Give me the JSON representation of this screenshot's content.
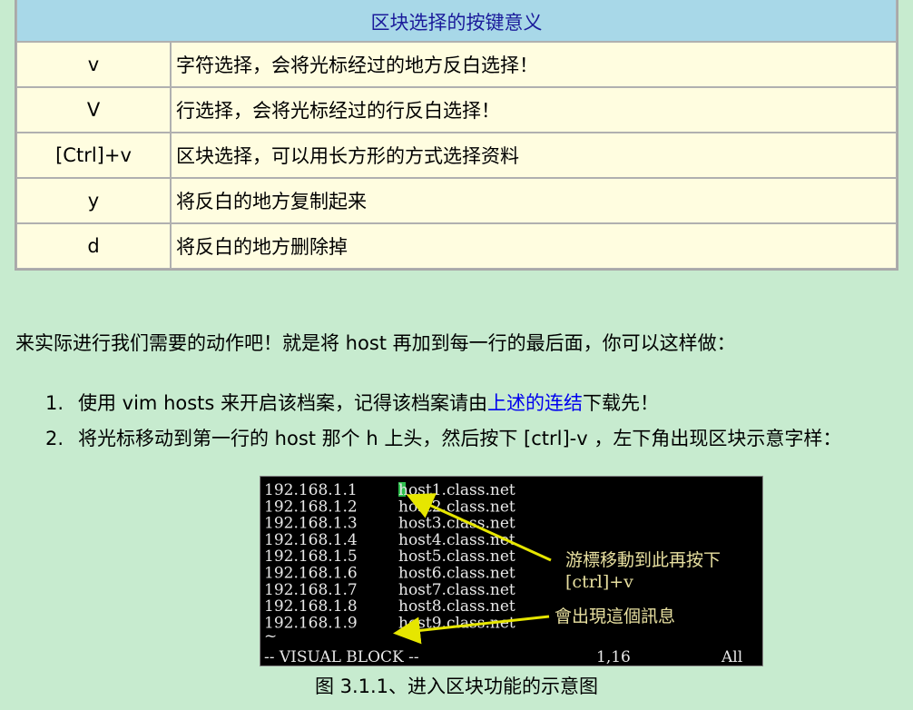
{
  "table": {
    "header": "区块选择的按键意义",
    "rows": [
      {
        "key": "v",
        "desc": "字符选择，会将光标经过的地方反白选择！"
      },
      {
        "key": "V",
        "desc": "行选择，会将光标经过的行反白选择！"
      },
      {
        "key": "[Ctrl]+v",
        "desc": "区块选择，可以用长方形的方式选择资料"
      },
      {
        "key": "y",
        "desc": "将反白的地方复制起来"
      },
      {
        "key": "d",
        "desc": "将反白的地方删除掉"
      }
    ]
  },
  "intro": "来实际进行我们需要的动作吧！就是将 host 再加到每一行的最后面，你可以这样做：",
  "steps": [
    {
      "num": "1.",
      "before": "使用 vim hosts 来开启该档案，记得该档案请由",
      "link": "上述的连结",
      "after": "下载先！"
    },
    {
      "num": "2.",
      "text": "将光标移动到第一行的 host 那个 h 上头，然后按下 [ctrl]-v ，左下角出现区块示意字样："
    }
  ],
  "terminal": {
    "lines": [
      {
        "ip": "192.168.1.1",
        "host": "host1.class.net"
      },
      {
        "ip": "192.168.1.2",
        "host": "host2.class.net"
      },
      {
        "ip": "192.168.1.3",
        "host": "host3.class.net"
      },
      {
        "ip": "192.168.1.4",
        "host": "host4.class.net"
      },
      {
        "ip": "192.168.1.5",
        "host": "host5.class.net"
      },
      {
        "ip": "192.168.1.6",
        "host": "host6.class.net"
      },
      {
        "ip": "192.168.1.7",
        "host": "host7.class.net"
      },
      {
        "ip": "192.168.1.8",
        "host": "host8.class.net"
      },
      {
        "ip": "192.168.1.9",
        "host": "host9.class.net"
      }
    ],
    "tilde": "~",
    "status_mode": "-- VISUAL BLOCK --",
    "status_pos": "1,16",
    "status_all": "All",
    "annotation1_line1": "游標移動到此再按下",
    "annotation1_line2": "[ctrl]+v",
    "annotation2": "會出現這個訊息"
  },
  "caption": "图 3.1.1、进入区块功能的示意图",
  "colors": {
    "page_bg": "#c7ebcf",
    "table_bg": "#fffde0",
    "header_bg": "#a8d8e8",
    "link": "#0000ee",
    "arrow": "#e6e600",
    "cursor": "#2fbf4f"
  }
}
